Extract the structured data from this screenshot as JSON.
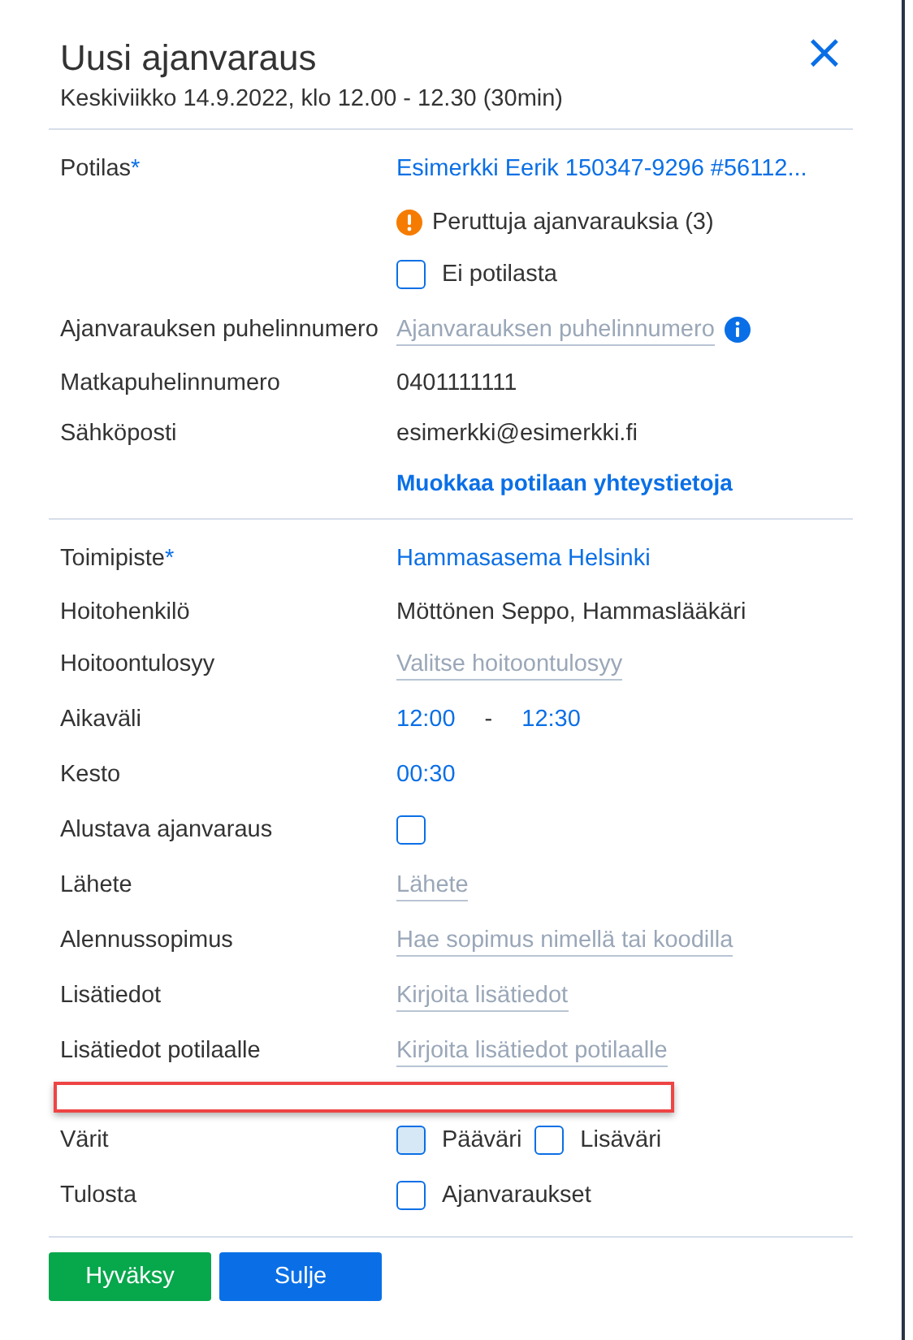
{
  "dialog": {
    "title": "Uusi ajanvaraus",
    "subtitle": "Keskiviikko 14.9.2022, klo 12.00 - 12.30 (30min)",
    "close": "×"
  },
  "sections": [
    {
      "rows": [
        {
          "kind": "link",
          "label": "Potilas",
          "required_mark": "*",
          "value": "Esimerkki Eerik 150347-9296 #56112..."
        },
        {
          "kind": "warning",
          "value": "Peruttuja ajanvarauksia (3)"
        },
        {
          "kind": "checks",
          "options": [
            {
              "label": "Ei potilasta",
              "checked": false,
              "highlighted": false
            }
          ]
        },
        {
          "kind": "field",
          "label": "Ajanvarauksen puhelinnumero",
          "placeholder": "Ajanvarauksen puhelinnumero",
          "info": true
        },
        {
          "kind": "text",
          "label": "Matkapuhelinnumero",
          "value": "0401111111"
        },
        {
          "kind": "text",
          "label": "Sähköposti",
          "value": "esimerkki@esimerkki.fi"
        },
        {
          "kind": "action",
          "value": "Muokkaa potilaan yhteystietoja"
        }
      ]
    },
    {
      "rows": [
        {
          "kind": "link",
          "label": "Toimipiste",
          "required_mark": "*",
          "value": "Hammasasema Helsinki"
        },
        {
          "kind": "text",
          "label": "Hoitohenkilö",
          "value": "Möttönen Seppo, Hammaslääkäri"
        },
        {
          "kind": "field",
          "label": "Hoitoontulosyy",
          "placeholder": "Valitse hoitoontulosyy"
        },
        {
          "kind": "time_range",
          "label": "Aikaväli",
          "start": "12:00",
          "separator": "-",
          "end": "12:30"
        },
        {
          "kind": "link",
          "label": "Kesto",
          "value": "00:30"
        },
        {
          "kind": "checks",
          "label": "Alustava ajanvaraus",
          "options": [
            {
              "checked": false,
              "highlighted": false
            }
          ]
        },
        {
          "kind": "field",
          "label": "Lähete",
          "placeholder": "Lähete"
        },
        {
          "kind": "field",
          "label": "Alennussopimus",
          "placeholder": "Hae sopimus nimellä tai koodilla"
        },
        {
          "kind": "field",
          "label": "Lisätiedot",
          "placeholder": "Kirjoita lisätiedot"
        },
        {
          "kind": "field",
          "label": "Lisätiedot potilaalle",
          "placeholder": "Kirjoita lisätiedot potilaalle"
        },
        {
          "kind": "marker"
        },
        {
          "kind": "checks",
          "label": "Värit",
          "options": [
            {
              "label": "Pääväri",
              "checked": false,
              "highlighted": true
            },
            {
              "label": "Lisäväri",
              "checked": false,
              "highlighted": false
            }
          ]
        },
        {
          "kind": "checks",
          "label": "Tulosta",
          "options": [
            {
              "label": "Ajanvaraukset",
              "checked": false,
              "highlighted": false
            }
          ]
        }
      ]
    }
  ],
  "buttons": [
    {
      "label": "Hyväksy",
      "kind": "primary"
    },
    {
      "label": "Sulje",
      "kind": "secondary"
    }
  ]
}
